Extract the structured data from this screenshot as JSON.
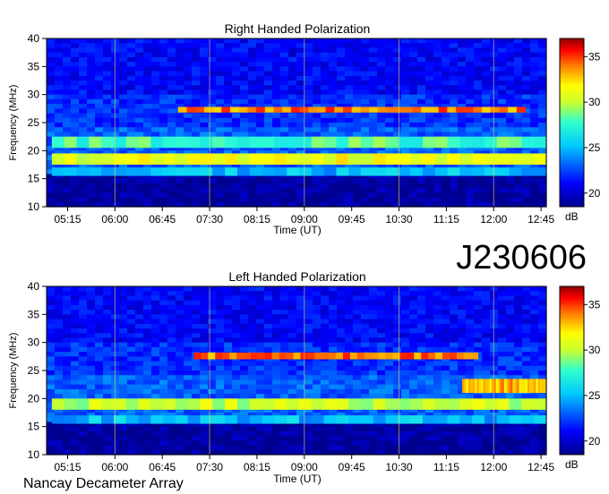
{
  "header": {
    "id_label": "J230606"
  },
  "footer": {
    "instrument": "Nancay Decameter Array"
  },
  "chart_data": [
    {
      "type": "heatmap",
      "title": "Right Handed Polarization",
      "xlabel": "Time (UT)",
      "ylabel": "Frequency (MHz)",
      "x_ticks": [
        "05:15",
        "06:00",
        "06:45",
        "07:30",
        "08:15",
        "09:00",
        "09:45",
        "10:30",
        "11:15",
        "12:00",
        "12:45"
      ],
      "x_range_minutes_ut": [
        295,
        770
      ],
      "y_ticks": [
        10,
        15,
        20,
        25,
        30,
        35,
        40
      ],
      "ylim": [
        10,
        40
      ],
      "colorbar": {
        "label": "dB",
        "ticks": [
          20,
          25,
          30,
          35
        ],
        "range": [
          18.5,
          37
        ]
      },
      "emission_bands": [
        {
          "freq_mhz": [
            26.8,
            27.8
          ],
          "time_ut": [
            "07:00",
            "12:30"
          ],
          "level_db": 34
        },
        {
          "freq_mhz": [
            17.5,
            19.5
          ],
          "time_ut": [
            "05:00",
            "12:50"
          ],
          "level_db": 31
        },
        {
          "freq_mhz": [
            20.5,
            22.5
          ],
          "time_ut": [
            "05:00",
            "12:50"
          ],
          "level_db": 28
        },
        {
          "freq_mhz": [
            15.5,
            17.0
          ],
          "time_ut": [
            "05:00",
            "12:50"
          ],
          "level_db": 25
        }
      ],
      "background_db": 21
    },
    {
      "type": "heatmap",
      "title": "Left Handed Polarization",
      "xlabel": "Time (UT)",
      "ylabel": "Frequency (MHz)",
      "x_ticks": [
        "05:15",
        "06:00",
        "06:45",
        "07:30",
        "08:15",
        "09:00",
        "09:45",
        "10:30",
        "11:15",
        "12:00",
        "12:45"
      ],
      "x_range_minutes_ut": [
        295,
        770
      ],
      "y_ticks": [
        10,
        15,
        20,
        25,
        30,
        35,
        40
      ],
      "ylim": [
        10,
        40
      ],
      "colorbar": {
        "label": "dB",
        "ticks": [
          20,
          25,
          30,
          35
        ],
        "range": [
          18.5,
          37
        ]
      },
      "emission_bands": [
        {
          "freq_mhz": [
            27.0,
            28.2
          ],
          "time_ut": [
            "07:15",
            "11:45"
          ],
          "level_db": 34
        },
        {
          "freq_mhz": [
            18.0,
            20.0
          ],
          "time_ut": [
            "05:00",
            "12:50"
          ],
          "level_db": 30
        },
        {
          "freq_mhz": [
            21.0,
            23.5
          ],
          "time_ut": [
            "11:30",
            "12:50"
          ],
          "level_db": 33
        },
        {
          "freq_mhz": [
            15.5,
            17.0
          ],
          "time_ut": [
            "05:00",
            "12:50"
          ],
          "level_db": 25
        }
      ],
      "background_db": 21
    }
  ]
}
